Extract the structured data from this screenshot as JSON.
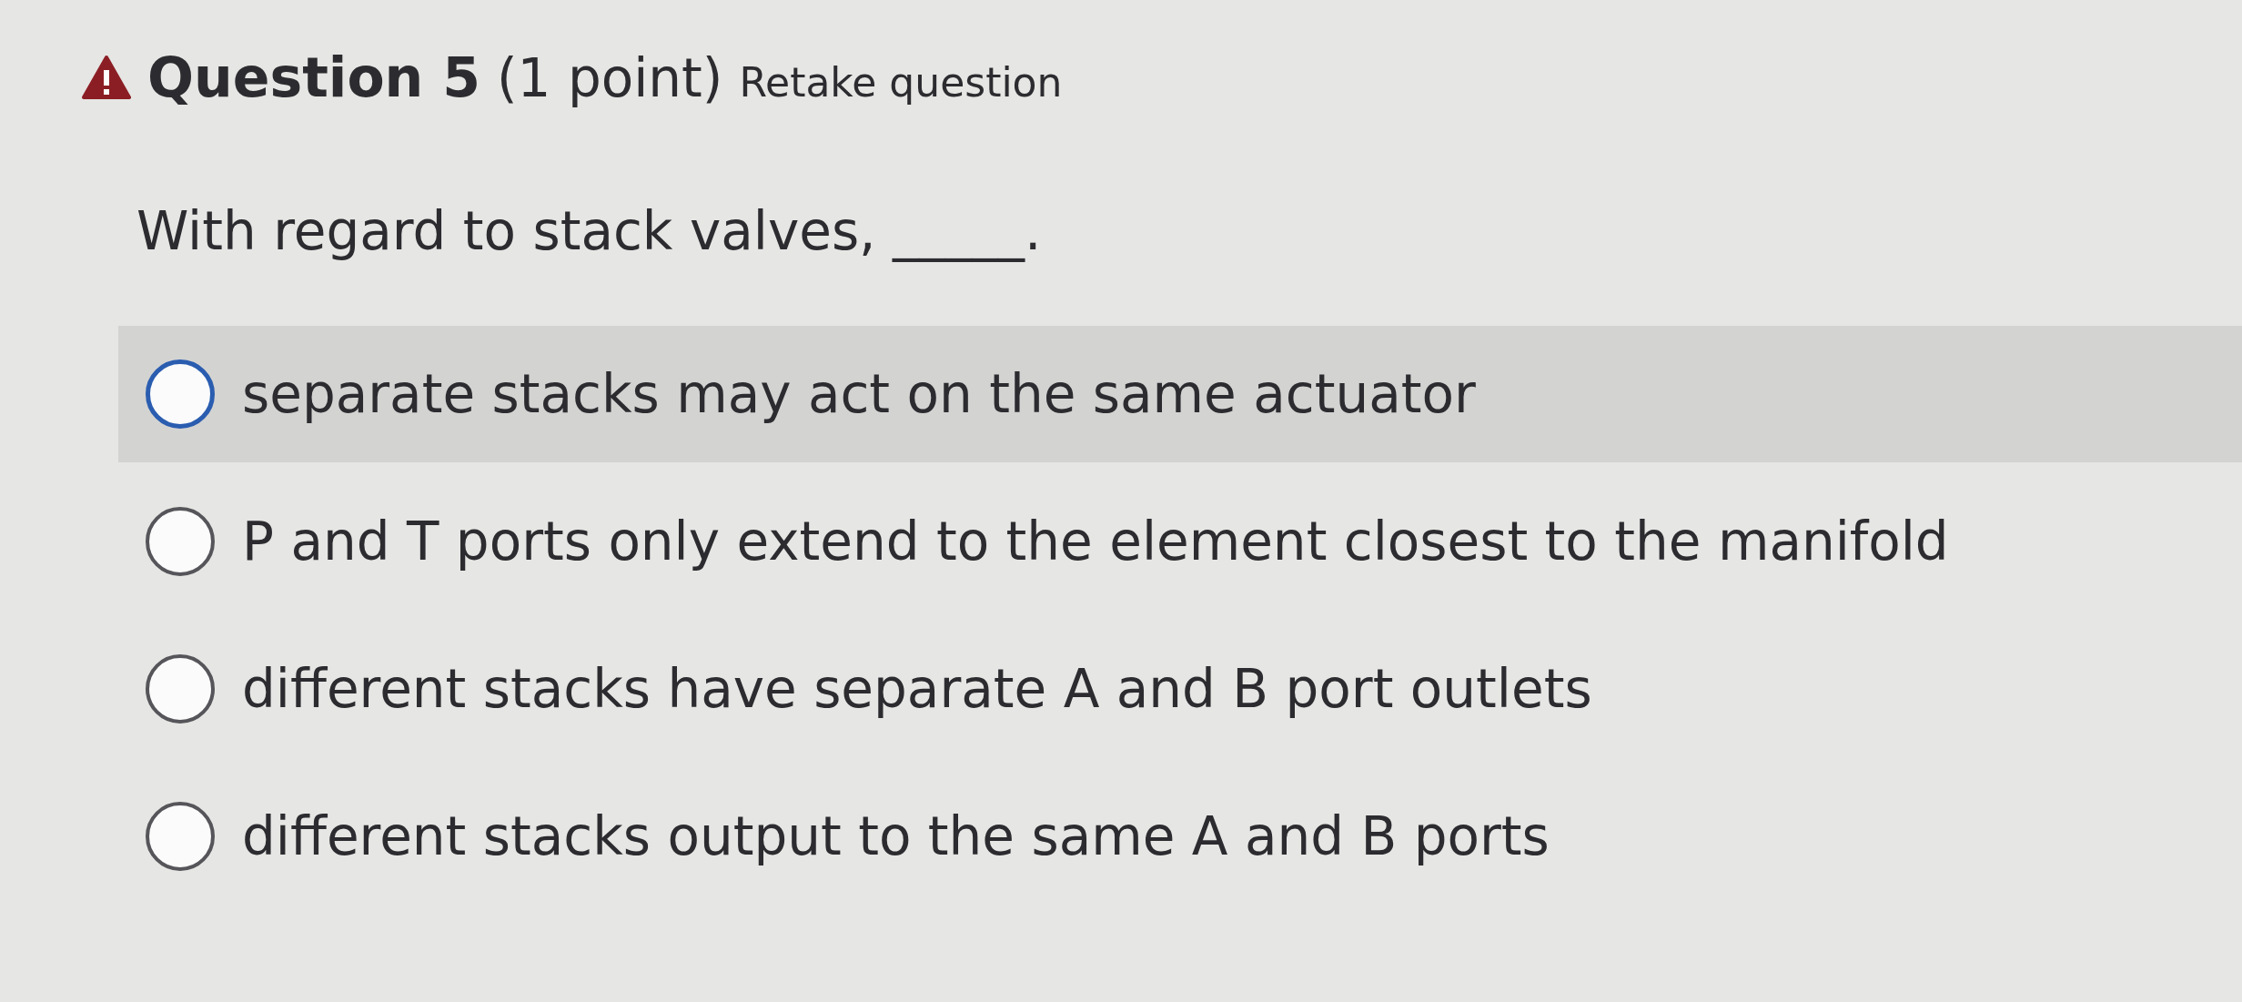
{
  "question": {
    "number_label": "Question 5",
    "points": "(1 point)",
    "retake_link": "Retake question",
    "warning": true,
    "prompt": "With regard to stack valves, _____."
  },
  "options": [
    {
      "label": "separate stacks may act on the same actuator",
      "selected": false,
      "highlighted": true
    },
    {
      "label": "P and T ports only extend to the element closest to the manifold",
      "selected": false,
      "highlighted": false
    },
    {
      "label": "different stacks have separate A and B port outlets",
      "selected": false,
      "highlighted": false
    },
    {
      "label": "different stacks output to the same A and B ports",
      "selected": false,
      "highlighted": false
    }
  ]
}
